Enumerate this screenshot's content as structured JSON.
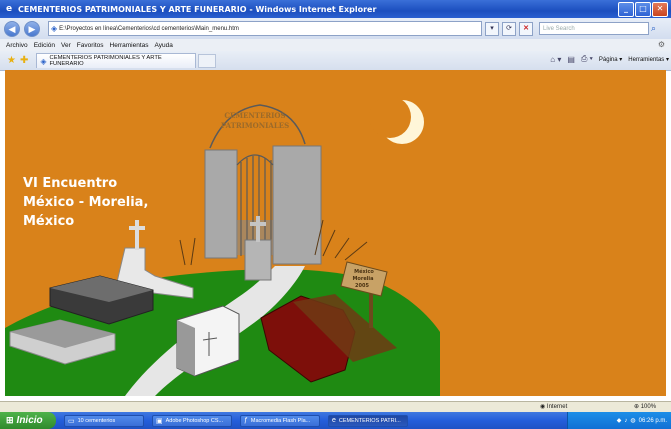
{
  "window": {
    "title": "CEMENTERIOS PATRIMONIALES Y ARTE FUNERARIO - Windows Internet Explorer",
    "icon": "ie-logo-icon"
  },
  "address_bar": {
    "url": "E:\\Proyectos en línea\\Cementerios\\cd cementerios\\Main_menu.htm",
    "search_placeholder": "Live Search"
  },
  "menu": {
    "items": [
      "Archivo",
      "Edición",
      "Ver",
      "Favoritos",
      "Herramientas",
      "Ayuda"
    ]
  },
  "tab": {
    "label": "CEMENTERIOS PATRIMONIALES Y ARTE FUNERARIO"
  },
  "command_bar": {
    "page_label": "Página",
    "tools_label": "Herramientas"
  },
  "page": {
    "background_color": "#d9821a",
    "arch_text_line1": "CEMENTERIOS",
    "arch_text_line2": "PATRIMONIALES",
    "event_line1": "VI Encuentro",
    "event_line2": "México - Morelia,",
    "event_line3": "México",
    "sign_line1": "México",
    "sign_line2": "Morelia",
    "sign_line3": "2005"
  },
  "status_bar": {
    "zone": "Internet",
    "zoom": "100%"
  },
  "taskbar": {
    "start_label": "Inicio",
    "buttons": [
      "10 cementerios",
      "Adobe Photoshop CS...",
      "Macromedia Flash Pla...",
      "CEMENTERIOS PATRI..."
    ],
    "clock": "06:26 p.m."
  }
}
